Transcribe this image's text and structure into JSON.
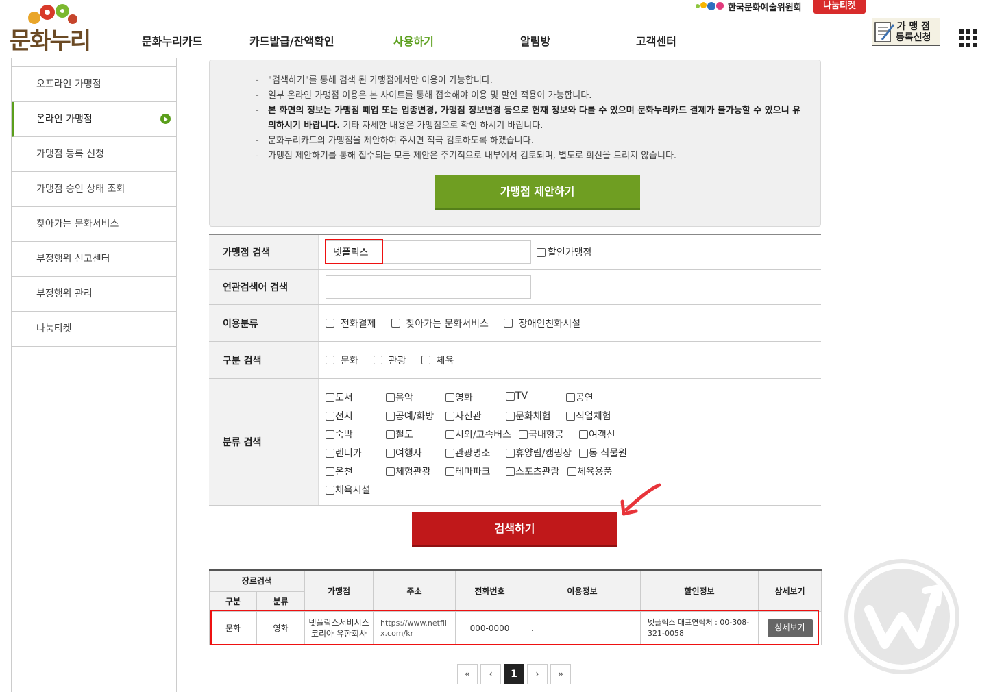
{
  "header": {
    "logo_text": "문화누리",
    "nav": [
      "문화누리카드",
      "카드발급/잔액확인",
      "사용하기",
      "알림방",
      "고객센터"
    ],
    "active_nav": "사용하기",
    "org_name": "한국문화예술위원회",
    "nanum_ticket": "나눔티켓",
    "register_line1": "가 맹 점",
    "register_line2": "등록신청"
  },
  "sidebar": {
    "items": [
      {
        "label": "오프라인 가맹점"
      },
      {
        "label": "온라인 가맹점"
      },
      {
        "label": "가맹점 등록 신청"
      },
      {
        "label": "가맹점 승인 상태 조회"
      },
      {
        "label": "찾아가는 문화서비스"
      },
      {
        "label": "부정행위 신고센터"
      },
      {
        "label": "부정행위 관리"
      },
      {
        "label": "나눔티켓"
      }
    ],
    "active_index": 1
  },
  "notice": {
    "line1": "\"검색하기\"를 통해 검색 된 가맹점에서만 이용이 가능합니다.",
    "line2": "일부 온라인 가맹점 이용은 본 사이트를 통해 접속해야 이용 및 할인 적용이 가능합니다.",
    "line3_bold": "본 화면의 정보는 가맹점 폐업 또는 업종변경, 가맹점 정보변경 등으로 현재 정보와 다를 수 있으며 문화누리카드 결제가 불가능할 수 있으니 유의하시기 바랍니다.",
    "line3_rest": " 기타 자세한 내용은 가맹점으로 확인 하시기 바랍니다.",
    "line4": "문화누리카드의 가맹점을 제안하여 주시면 적극 검토하도록 하겠습니다.",
    "line5": "가맹점 제안하기를 통해 접수되는 모든 제안은 주기적으로 내부에서 검토되며, 별도로 회신을 드리지 않습니다.",
    "propose_button": "가맹점 제안하기"
  },
  "search_form": {
    "store_search_label": "가맹점 검색",
    "store_search_value": "넷플릭스",
    "discount_store_label": "할인가맹점",
    "related_keyword_label": "연관검색어 검색",
    "related_keyword_value": "",
    "usage_label": "이용분류",
    "usage_options": [
      "전화결제",
      "찾아가는 문화서비스",
      "장애인친화시설"
    ],
    "division_label": "구분 검색",
    "division_options": [
      "문화",
      "관광",
      "체육"
    ],
    "category_label": "분류 검색",
    "categories": [
      "도서",
      "음악",
      "영화",
      "TV",
      "공연",
      "전시",
      "공예/화방",
      "사진관",
      "문화체험",
      "직업체험",
      "숙박",
      "철도",
      "시외/고속버스",
      "국내항공",
      "여객선",
      "렌터카",
      "여행사",
      "관광명소",
      "휴양림/캠핑장",
      "동 식물원",
      "온천",
      "체험관광",
      "테마파크",
      "스포츠관람",
      "체육용품",
      "체육시설"
    ],
    "search_button": "검색하기"
  },
  "results": {
    "headers": {
      "genre": "장르검색",
      "division": "구분",
      "category": "분류",
      "store": "가맹점",
      "address": "주소",
      "phone": "전화번호",
      "usage": "이용정보",
      "discount": "할인정보",
      "detail": "상세보기"
    },
    "rows": [
      {
        "division": "문화",
        "category": "영화",
        "store": "넷플릭스서비시스코리아 유한회사",
        "address": "https://www.netflix.com/kr",
        "phone": "000-0000",
        "usage": ".",
        "discount": "넷플릭스 대표연락처 : 00-308-321-0058",
        "detail_button": "상세보기"
      }
    ]
  },
  "pagination": {
    "first": "«",
    "prev": "‹",
    "current": "1",
    "next": "›",
    "last": "»"
  },
  "colors": {
    "accent_green": "#5a9e1b",
    "propose_green": "#6f9e22",
    "search_red": "#c0181a",
    "highlight_red": "#e11111"
  }
}
